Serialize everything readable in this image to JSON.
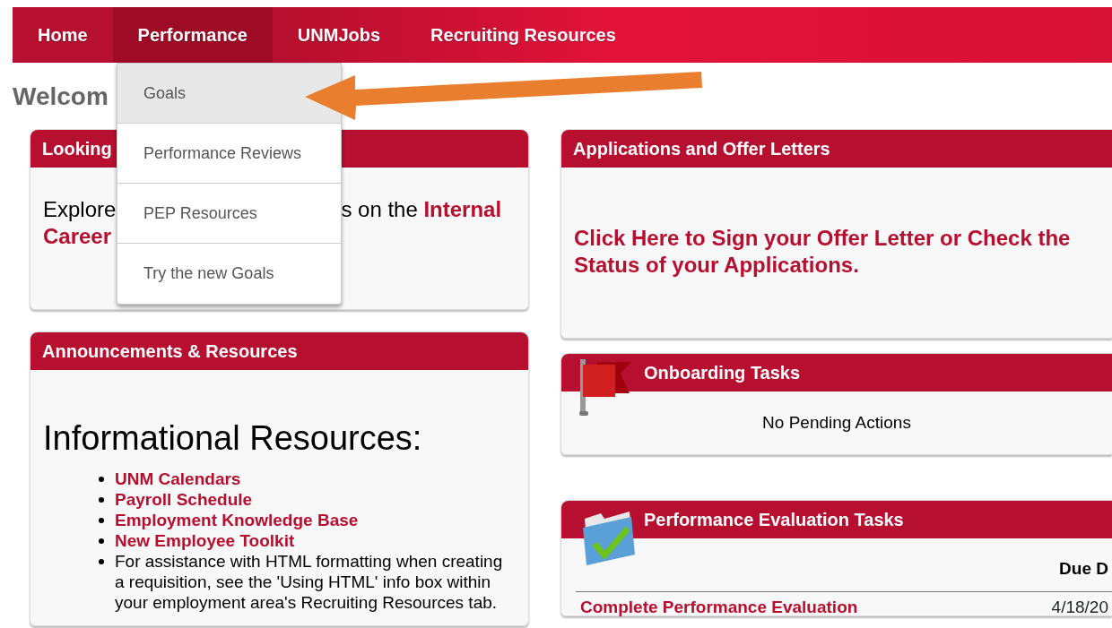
{
  "nav": {
    "items": [
      {
        "label": "Home",
        "selected": false
      },
      {
        "label": "Performance",
        "selected": true
      },
      {
        "label": "UNMJobs",
        "selected": false
      },
      {
        "label": "Recruiting Resources",
        "selected": false
      }
    ]
  },
  "dropdown": {
    "items": [
      {
        "label": "Goals",
        "selected": true
      },
      {
        "label": "Performance Reviews",
        "selected": false
      },
      {
        "label": "PEP Resources",
        "selected": false
      },
      {
        "label": "Try the new Goals",
        "selected": false
      }
    ]
  },
  "welcome": "Welcom",
  "looking_card": {
    "title": "Looking",
    "text_before": "Explore",
    "text_after": "s on the",
    "link_line1": "Internal",
    "link_line2": "Career"
  },
  "announcements": {
    "title": "Announcements & Resources",
    "heading": "Informational Resources:",
    "items": [
      {
        "kind": "link",
        "text": "UNM Calendars"
      },
      {
        "kind": "link",
        "text": "Payroll Schedule"
      },
      {
        "kind": "link",
        "text": "Employment Knowledge Base"
      },
      {
        "kind": "link",
        "text": "New Employee Toolkit"
      },
      {
        "kind": "text",
        "text": "For assistance with HTML formatting when creating a requisition, see the 'Using HTML' info box within your employment area's Recruiting Resources tab."
      }
    ]
  },
  "applications": {
    "title": "Applications and Offer Letters",
    "link": "Click Here to Sign your Offer Letter or Check the Status of your Applications."
  },
  "onboarding": {
    "title": "Onboarding Tasks",
    "message": "No Pending Actions"
  },
  "performance_tasks": {
    "title": "Performance Evaluation Tasks",
    "columns": [
      "Due D"
    ],
    "rows": [
      {
        "task": "Complete Performance Evaluation",
        "due": "4/18/20"
      }
    ]
  }
}
